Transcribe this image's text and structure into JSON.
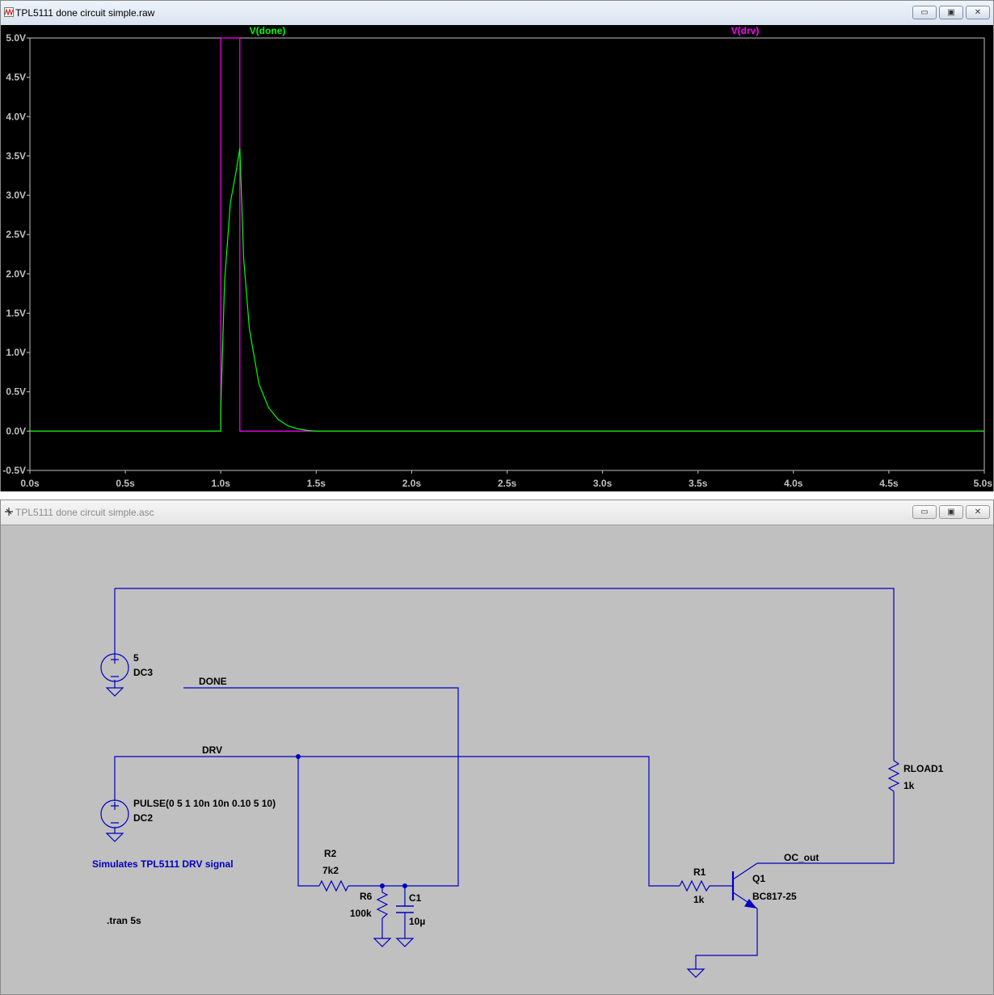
{
  "waveform_window": {
    "title": "TPL5111 done circuit simple.raw",
    "buttons": {
      "minimize": "▭",
      "restore": "▣",
      "close": "✕"
    },
    "background": "#000000",
    "trace_labels": [
      {
        "name": "V(done)",
        "color": "#00ff00"
      },
      {
        "name": "V(drv)",
        "color": "#ff00ff"
      }
    ]
  },
  "schematic_window": {
    "title": "TPL5111 done circuit simple.asc",
    "buttons": {
      "minimize": "▭",
      "restore": "▣",
      "close": "✕"
    },
    "wire_color": "#0000c0",
    "labels": {
      "v3_value": "5",
      "v3_name": "DC3",
      "done_net": "DONE",
      "drv_net": "DRV",
      "v2_value": "PULSE(0 5 1 10n 10n 0.10 5 10)",
      "v2_name": "DC2",
      "comment": "Simulates TPL5111 DRV signal",
      "tran": ".tran 5s",
      "r2_name": "R2",
      "r2_value": "7k2",
      "r6_name": "R6",
      "r6_value": "100k",
      "c1_name": "C1",
      "c1_value": "10µ",
      "r1_name": "R1",
      "r1_value": "1k",
      "q1_name": "Q1",
      "q1_model": "BC817-25",
      "oc_net": "OC_out",
      "rload_name": "RLOAD1",
      "rload_value": "1k"
    }
  },
  "chart_data": {
    "type": "line",
    "xlabel": "",
    "ylabel": "",
    "xlim": [
      0,
      5
    ],
    "ylim": [
      -0.5,
      5
    ],
    "x_ticks": [
      "0.0s",
      "0.5s",
      "1.0s",
      "1.5s",
      "2.0s",
      "2.5s",
      "3.0s",
      "3.5s",
      "4.0s",
      "4.5s",
      "5.0s"
    ],
    "y_ticks": [
      "5.0V",
      "4.5V",
      "4.0V",
      "3.5V",
      "3.0V",
      "2.5V",
      "2.0V",
      "1.5V",
      "1.0V",
      "0.5V",
      "0.0V",
      "-0.5V"
    ],
    "series": [
      {
        "name": "V(drv)",
        "color": "#ff00ff",
        "x": [
          0,
          1.0,
          1.0,
          1.1,
          1.1,
          5.0
        ],
        "y": [
          0,
          0,
          5,
          5,
          0,
          0
        ]
      },
      {
        "name": "V(done)",
        "color": "#00ff00",
        "x": [
          0,
          1.0,
          1.0,
          1.02,
          1.05,
          1.08,
          1.1,
          1.12,
          1.15,
          1.2,
          1.25,
          1.3,
          1.35,
          1.4,
          1.45,
          1.5,
          5.0
        ],
        "y": [
          0,
          0,
          0.3,
          1.9,
          2.9,
          3.3,
          3.6,
          2.2,
          1.3,
          0.6,
          0.3,
          0.15,
          0.07,
          0.03,
          0.01,
          0.0,
          0.0
        ]
      }
    ]
  }
}
